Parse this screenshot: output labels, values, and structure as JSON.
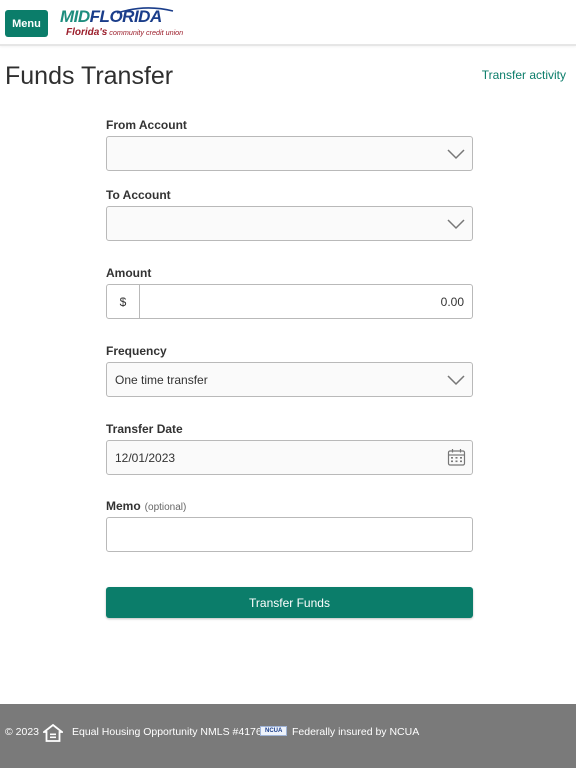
{
  "header": {
    "menu_label": "Menu",
    "logo": {
      "word_mid": "MID",
      "word_florida": "FLORIDA",
      "tag_script": "Florida's",
      "tag_rest": " community credit union"
    }
  },
  "page": {
    "title": "Funds Transfer",
    "activity_link": "Transfer activity"
  },
  "form": {
    "from_account": {
      "label": "From Account",
      "value": ""
    },
    "to_account": {
      "label": "To Account",
      "value": ""
    },
    "amount": {
      "label": "Amount",
      "prefix": "$",
      "value": "0.00"
    },
    "frequency": {
      "label": "Frequency",
      "value": "One time transfer"
    },
    "transfer_date": {
      "label": "Transfer Date",
      "value": "12/01/2023"
    },
    "memo": {
      "label": "Memo",
      "optional": "(optional)",
      "value": ""
    },
    "submit_label": "Transfer Funds"
  },
  "footer": {
    "copyright": "© 2023",
    "equal_housing": "Equal Housing Opportunity",
    "nmls": "NMLS #417627",
    "ncua_badge": "NCUA",
    "insured": "Federally insured by NCUA"
  },
  "icons": {
    "chevron": "chevron-down-icon",
    "calendar": "calendar-icon",
    "equal_housing": "equal-housing-icon"
  },
  "colors": {
    "accent": "#0b7d6a",
    "footer_bg": "#7a7a7a",
    "logo_mid": "#1e8d7e",
    "logo_florida": "#1a3d8a",
    "logo_tag": "#9b1d2a"
  }
}
